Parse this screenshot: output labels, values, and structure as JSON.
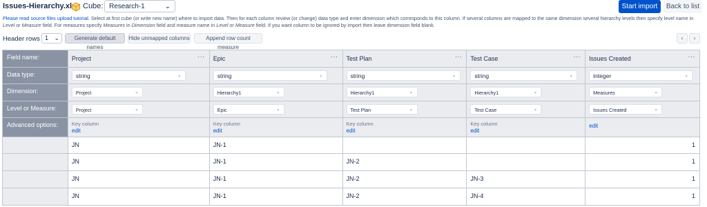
{
  "header": {
    "file_title": "Issues-Hierarchy.xlsx",
    "cube_label": "Cube:",
    "cube_value": "Research-1",
    "start_import_label": "Start import",
    "back_to_list_label": "Back to list"
  },
  "instructions": {
    "link_text": "Please read source files upload tutorial",
    "text_1": ". Select at first cube (or write new name) where to import data. Then for each column review (or change) data type and enter dimension which corresponds to this column. If several columns are mapped to the same dimension several hierarchy levels then specify level name in ",
    "em_1": "Level or Measure",
    "text_2": " field. For measures specify ",
    "em_2": "Measures",
    "text_3": " in ",
    "em_3": "Dimension",
    "text_4": " field and measure name in ",
    "em_4": "Level or Measure",
    "text_5": " field. If you want column to be ignored by import then leave dimension field blank."
  },
  "toolbar": {
    "header_rows_label": "Header rows",
    "header_rows_value": "1",
    "generate_label": "Generate default names",
    "hide_label": "Hide unmapped columns",
    "append_label": "Append row count measure"
  },
  "rows": {
    "field_name": "Field name:",
    "data_type": "Data type:",
    "dimension": "Dimension:",
    "level": "Level or Measure:",
    "advanced": "Advanced options:"
  },
  "columns": [
    {
      "name": "Project",
      "type": "string",
      "dimension": "Project",
      "level": "Project",
      "key": "Key column",
      "edit": "edit"
    },
    {
      "name": "Epic",
      "type": "string",
      "dimension": "Hierarchy1",
      "level": "Epic",
      "key": "Key column",
      "edit": "edit"
    },
    {
      "name": "Test Plan",
      "type": "string",
      "dimension": "Hierarchy1",
      "level": "Test Plan",
      "key": "Key column",
      "edit": "edit"
    },
    {
      "name": "Test Case",
      "type": "string",
      "dimension": "Hierarchy1",
      "level": "Test Case",
      "key": "Key column",
      "edit": "edit"
    },
    {
      "name": "Issues Created",
      "type": "integer",
      "dimension": "Measures",
      "level": "Issues Created",
      "key": "",
      "edit": "edit"
    }
  ],
  "data_rows": [
    [
      "JN",
      "JN-1",
      "",
      "",
      "1"
    ],
    [
      "JN",
      "JN-1",
      "JN-2",
      "",
      "1"
    ],
    [
      "JN",
      "JN-1",
      "JN-2",
      "JN-3",
      "1"
    ],
    [
      "JN",
      "JN-1",
      "JN-2",
      "JN-4",
      "1"
    ]
  ],
  "icons": {
    "cube": "cube-icon",
    "chevron": "chevron-down-icon",
    "more": "more-icon",
    "prev": "chevron-left-icon",
    "next": "chevron-right-icon"
  },
  "colors": {
    "primary": "#0052cc",
    "row_header": "#8993a4",
    "link": "#0052cc"
  }
}
